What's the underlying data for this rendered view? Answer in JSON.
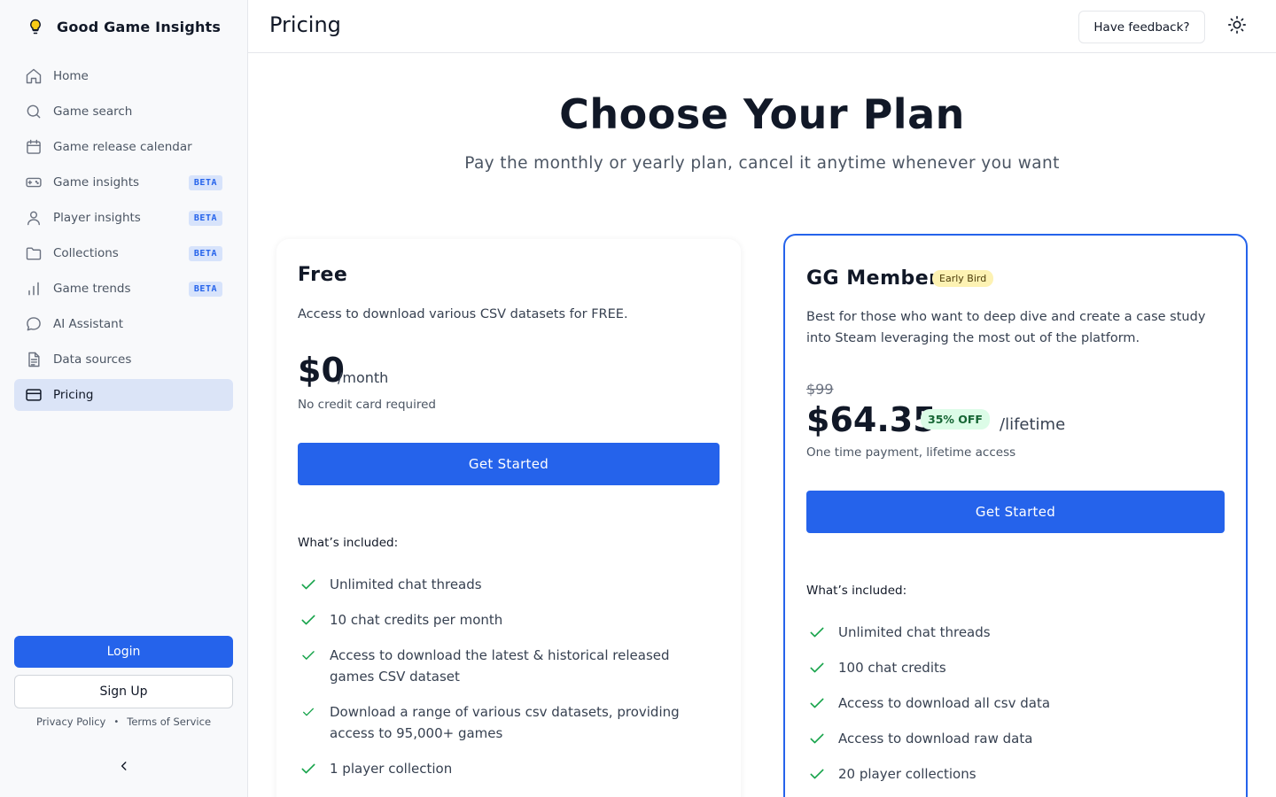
{
  "app": {
    "name": "Good Game Insights"
  },
  "sidebar": {
    "items": [
      {
        "label": "Home",
        "icon": "home-icon"
      },
      {
        "label": "Game search",
        "icon": "search-icon"
      },
      {
        "label": "Game release calendar",
        "icon": "calendar-icon"
      },
      {
        "label": "Game insights",
        "icon": "gamepad-icon",
        "badge": "BETA"
      },
      {
        "label": "Player insights",
        "icon": "user-icon",
        "badge": "BETA"
      },
      {
        "label": "Collections",
        "icon": "folder-icon",
        "badge": "BETA"
      },
      {
        "label": "Game trends",
        "icon": "bar-chart-icon",
        "badge": "BETA"
      },
      {
        "label": "AI Assistant",
        "icon": "chat-bubble-icon"
      },
      {
        "label": "Data sources",
        "icon": "document-icon"
      },
      {
        "label": "Pricing",
        "icon": "credit-card-icon",
        "active": true
      }
    ],
    "login_label": "Login",
    "signup_label": "Sign Up",
    "privacy_label": "Privacy Policy",
    "terms_label": "Terms of Service",
    "separator": "•"
  },
  "header": {
    "title": "Pricing",
    "feedback_label": "Have feedback?"
  },
  "hero": {
    "title": "Choose Your Plan",
    "subtitle": "Pay the monthly or yearly plan, cancel it anytime whenever you want"
  },
  "plans": {
    "free": {
      "name": "Free",
      "description": "Access to download various CSV datasets for FREE.",
      "price": "$0",
      "period": "/month",
      "note": "No credit card required",
      "cta": "Get Started",
      "included_title": "What’s included:",
      "features": [
        "Unlimited chat threads",
        "10 chat credits per month",
        "Access to download the latest & historical released games CSV dataset",
        "Download a range of various csv datasets, providing access to 95,000+ games",
        "1 player collection"
      ]
    },
    "member": {
      "name": "GG Member",
      "tag": "Early Bird",
      "description": "Best for those who want to deep dive and create a case study into Steam leveraging the most out of the platform.",
      "old_price": "$99",
      "price": "$64.35",
      "discount": "35% OFF",
      "period": "/lifetime",
      "note": "One time payment, lifetime access",
      "cta": "Get Started",
      "included_title": "What’s included:",
      "features": [
        "Unlimited chat threads",
        "100 chat credits",
        "Access to download all csv data",
        "Access to download raw data",
        "20 player collections"
      ]
    }
  },
  "colors": {
    "accent": "#2563eb",
    "active_nav_bg": "#dbe4f7",
    "check_green": "#16a34a",
    "early_bird_bg": "#fdf2b3",
    "discount_bg": "#dcfce7"
  }
}
